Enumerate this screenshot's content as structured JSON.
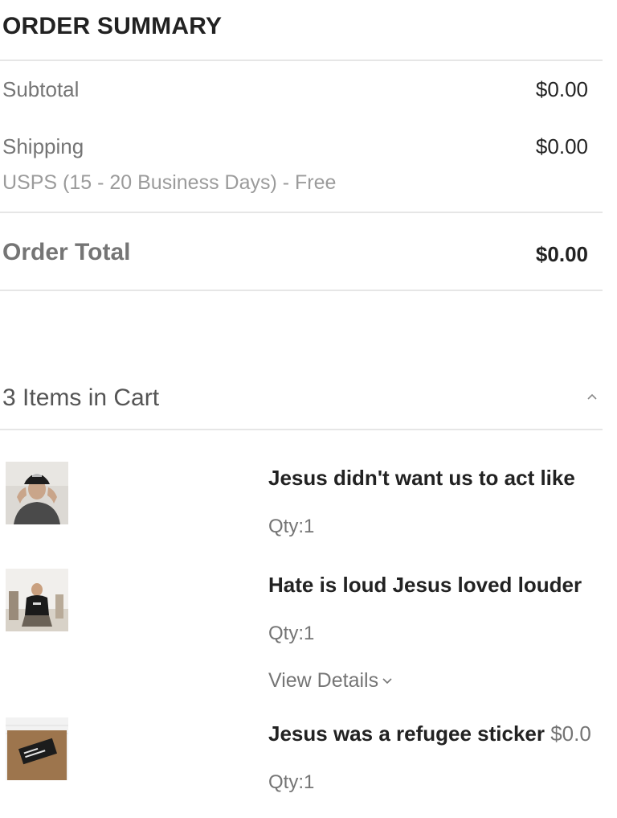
{
  "summary": {
    "title": "ORDER SUMMARY",
    "subtotal_label": "Subtotal",
    "subtotal_value": "$0.00",
    "shipping_label": "Shipping",
    "shipping_value": "$0.00",
    "shipping_method": "USPS (15 - 20 Business Days) - Free",
    "total_label": "Order Total",
    "total_value": "$0.00"
  },
  "cart": {
    "title": "3 Items in Cart",
    "toggle_icon": "chevron-up-icon",
    "items": [
      {
        "name": "Jesus didn't want us to act like",
        "price": "",
        "qty": "Qty:1",
        "image": "man-in-black-cap-photo"
      },
      {
        "name": "Hate is loud Jesus loved louder",
        "price": "",
        "qty": "Qty:1",
        "details_label": "View Details",
        "details_icon": "chevron-down-icon",
        "image": "man-in-black-tshirt-photo"
      },
      {
        "name": "Jesus was a refugee sticker ",
        "price": "$0.0",
        "qty": "Qty:1",
        "image": "sticker-on-cardboard-photo"
      }
    ]
  },
  "colors": {
    "text_dark": "#222222",
    "text_muted": "#757575",
    "text_light": "#9b9b9b",
    "divider": "#e6e6e6"
  }
}
